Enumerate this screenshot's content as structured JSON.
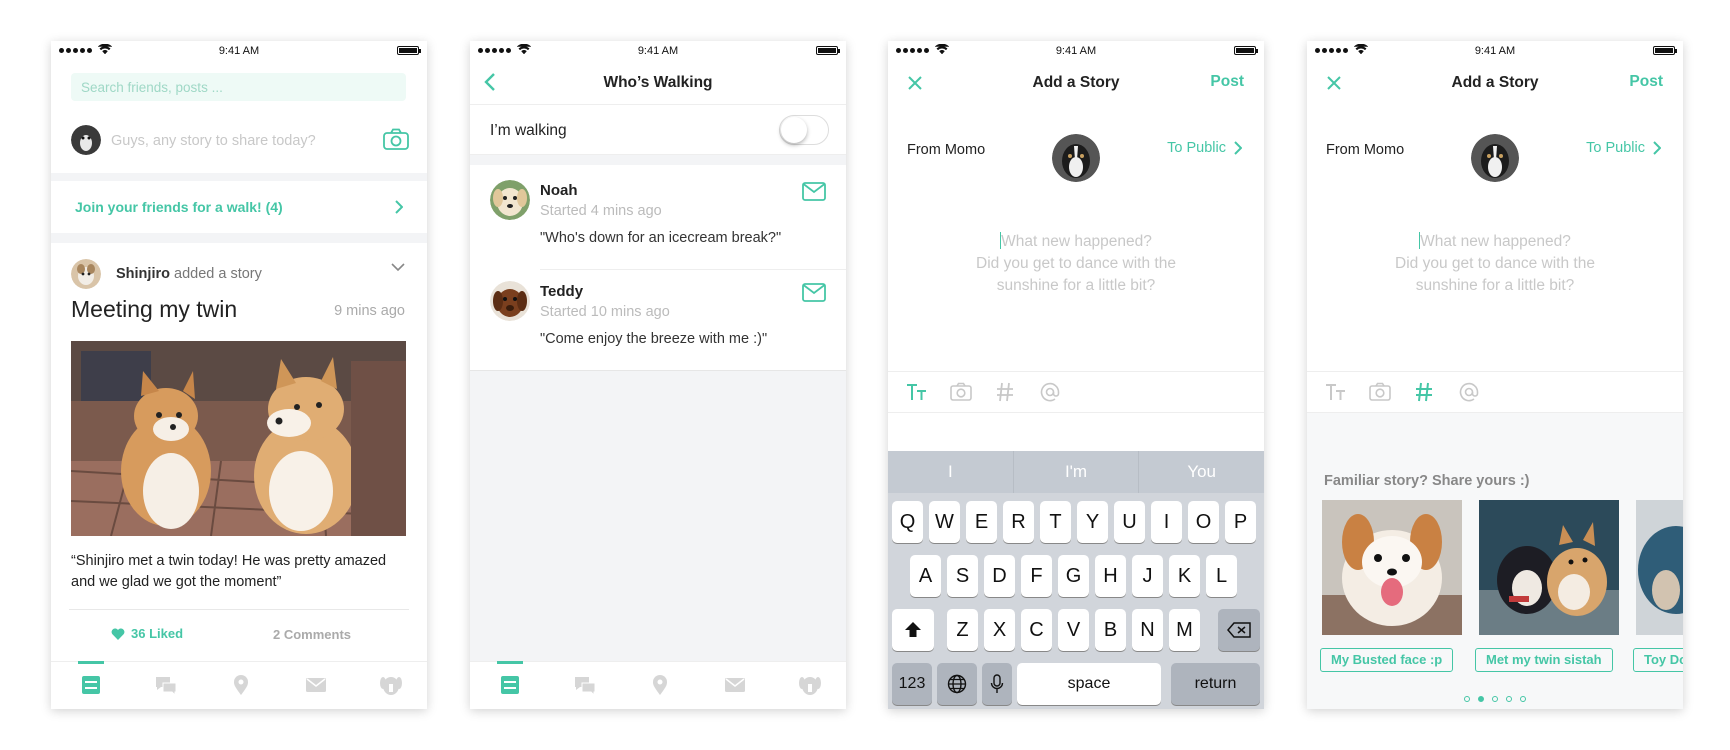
{
  "status": {
    "time": "9:41 AM"
  },
  "feed": {
    "search_placeholder": "Search friends, posts ...",
    "composer_placeholder": "Guys, any story to share today?",
    "join_label": "Join your friends for a walk! (4)",
    "post": {
      "author": "Shinjiro",
      "action": " added a story",
      "title": "Meeting my twin",
      "time": "9 mins ago",
      "quote": "“Shinjiro met a twin today! He was pretty amazed and we glad we got the moment”",
      "likes": "36 Liked",
      "comments": "2 Comments"
    }
  },
  "walking": {
    "title": "Who’s Walking",
    "toggle_label": "I’m walking",
    "walkers": [
      {
        "name": "Noah",
        "started": "Started 4 mins ago",
        "message": "\"Who's down for an icecream break?\""
      },
      {
        "name": "Teddy",
        "started": "Started 10 mins ago",
        "message": "\"Come enjoy the breeze with me :)\""
      }
    ]
  },
  "story": {
    "title": "Add a Story",
    "post_label": "Post",
    "from": "From Momo",
    "to": "To Public",
    "placeholder_line1": "What new happened?",
    "placeholder_line2": "Did you get to dance with the",
    "placeholder_line3": "sunshine for a little bit?"
  },
  "keyboard": {
    "suggestions": [
      "I",
      "I'm",
      "You"
    ],
    "row1": [
      "Q",
      "W",
      "E",
      "R",
      "T",
      "Y",
      "U",
      "I",
      "O",
      "P"
    ],
    "row2": [
      "A",
      "S",
      "D",
      "F",
      "G",
      "H",
      "J",
      "K",
      "L"
    ],
    "row3": [
      "Z",
      "X",
      "C",
      "V",
      "B",
      "N",
      "M"
    ],
    "numbers": "123",
    "space": "space",
    "return": "return"
  },
  "familiar": {
    "heading": "Familiar story? Share yours :)",
    "tags": [
      "My Busted face :p",
      "Met my twin sistah",
      "Toy Do"
    ]
  },
  "colors": {
    "accent": "#45c6a6",
    "gap": "#f3f4f6",
    "keyboard": "#d1d5db"
  },
  "icons": [
    "camera-icon",
    "chevron-right-icon",
    "heart-icon",
    "mail-icon",
    "close-icon",
    "text-format-icon",
    "hashtag-icon",
    "at-icon",
    "globe-icon",
    "mic-icon",
    "shift-icon",
    "backspace-icon"
  ]
}
